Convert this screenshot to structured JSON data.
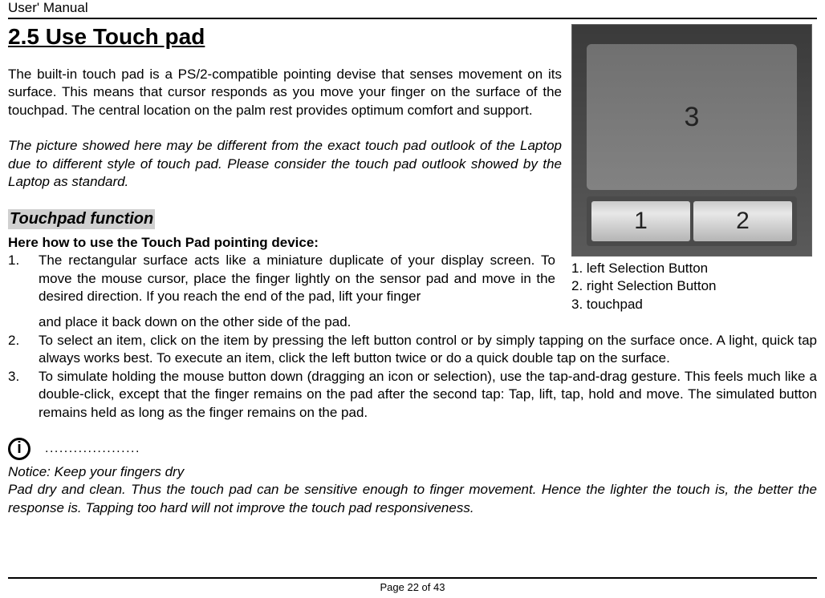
{
  "header": {
    "title": "User' Manual"
  },
  "section": {
    "title": "2.5 Use Touch pad",
    "intro": "The built-in touch pad is a PS/2-compatible pointing devise that senses movement on its surface. This means that cursor responds as you move your finger on the surface of the touchpad. The central location on the palm rest provides optimum comfort and support.",
    "italic_note": "The picture showed here may be different from the exact touch pad outlook of the Laptop due to different style of touch pad. Please consider the touch pad outlook showed by the Laptop as standard.",
    "subsection_title": "Touchpad function",
    "how_to_heading": "Here how to use the Touch Pad pointing device:",
    "list": {
      "item1_num": "1.",
      "item1_text_a": "The rectangular surface acts like a miniature duplicate of your display screen. To move the mouse cursor, place the finger lightly on the sensor pad and move in the desired direction. If you reach the end of the pad, lift your finger",
      "item1_text_b": "and place it back down on the other side of the pad.",
      "item2_num": "2.",
      "item2_text": "To select an item, click on the item by pressing the left button control or by simply tapping on the surface once. A light, quick tap always works best. To execute an item, click the left button twice or do a quick double tap on the surface.",
      "item3_num": "3.",
      "item3_text": "To simulate holding the mouse button down (dragging an icon or selection), use the tap-and-drag gesture. This feels much like a double-click, except that the finger remains on the pad after the second tap: Tap, lift, tap, hold and move. The simulated button remains held as long as the finger remains on the pad."
    },
    "notice": {
      "dots": "....................",
      "line1": "Notice: Keep your fingers dry",
      "line2": "Pad dry and clean. Thus the touch pad can be sensitive enough to finger movement. Hence the lighter the touch is, the better the response is. Tapping too hard will not improve the touch pad responsiveness."
    }
  },
  "image": {
    "label_3": "3",
    "label_1": "1",
    "label_2": "2",
    "caption1": "1. left Selection Button",
    "caption2": "2. right Selection Button",
    "caption3": "3. touchpad"
  },
  "icons": {
    "info": "i"
  },
  "footer": {
    "page": "Page 22 of 43"
  }
}
